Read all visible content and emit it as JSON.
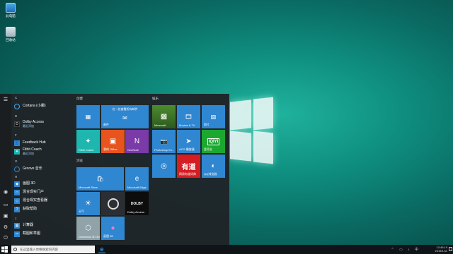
{
  "desktop": {
    "icons": [
      {
        "label": "此电脑"
      },
      {
        "label": "回收站"
      }
    ]
  },
  "start_menu": {
    "sections": [
      {
        "letter": "C"
      },
      {
        "letter": "D"
      },
      {
        "letter": "F"
      },
      {
        "letter": "G"
      },
      {
        "letter": "H"
      },
      {
        "letter": "J"
      }
    ],
    "apps": [
      {
        "name": "Cortana (小娜)",
        "sub": ""
      },
      {
        "name": "Dolby Access",
        "sub": "最近添加"
      },
      {
        "name": "Feedback Hub",
        "sub": ""
      },
      {
        "name": "Fitbit Coach",
        "sub": "最近添加"
      },
      {
        "name": "Groove 音乐",
        "sub": ""
      },
      {
        "name": "画图 3D",
        "sub": ""
      },
      {
        "name": "混合现实门户",
        "sub": ""
      },
      {
        "name": "混合现实查看器",
        "sub": ""
      },
      {
        "name": "获取帮助",
        "sub": ""
      },
      {
        "name": "计算器",
        "sub": ""
      },
      {
        "name": "截图和草图",
        "sub": ""
      }
    ],
    "groups": {
      "create": "创建",
      "explore": "浏览",
      "play": "娱乐"
    },
    "tiles": {
      "calendar": "",
      "mail": "邮件",
      "fitbit": "Fitbit Coach",
      "office": "我的 Office",
      "onenote": "OneNote",
      "store": "Microsoft Store",
      "edge": "Microsoft Edge",
      "weather": "天气",
      "cortana": "",
      "dolby": "Dolby Access",
      "download": "Download 3D 3d",
      "paint3d": "画图 3D",
      "minecraft": "Minecraft",
      "movies": "Movies & TV",
      "photos": "照片",
      "photostudio": "Photoshop Ex...",
      "acg": "ACG 播放器",
      "iqiyi": "爱奇艺",
      "weibo": "",
      "youdao": "网易有道词典",
      "qq": "QQ浏览器"
    },
    "tile_text": {
      "calendar_header": "在一处查看所有邮件",
      "youdao_glyph": "有道",
      "iqiyi_glyph": "iQIYI",
      "dolby_glyph": "DOLBY"
    }
  },
  "taskbar": {
    "search_placeholder": "在这里输入你要搜索的内容",
    "time": "13:45:19",
    "date": "2019/1/11"
  },
  "colors": {
    "accent": "#2f86d1",
    "tile_blue": "#2f86d1",
    "taskbar": "#101418"
  }
}
